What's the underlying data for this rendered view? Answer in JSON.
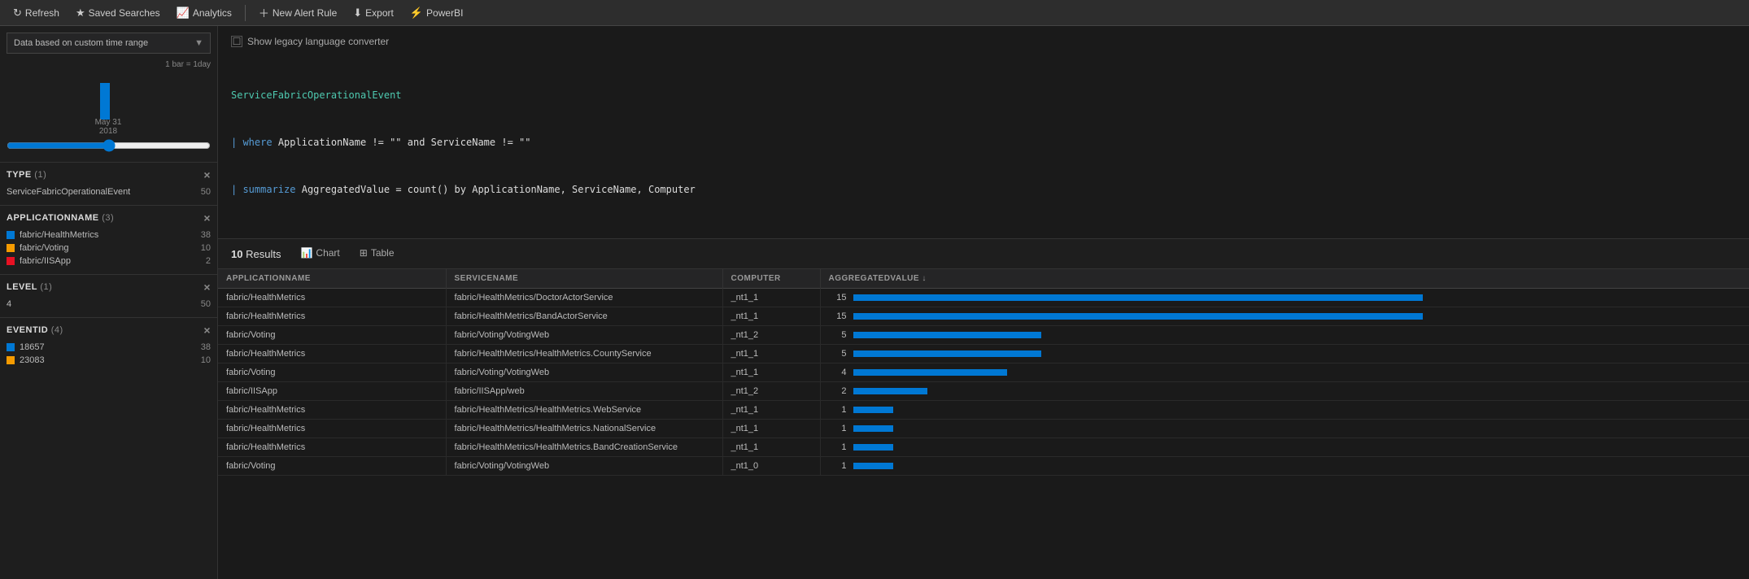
{
  "nav": {
    "refresh_label": "Refresh",
    "saved_searches_label": "Saved Searches",
    "analytics_label": "Analytics",
    "new_alert_label": "New Alert Rule",
    "export_label": "Export",
    "powerbi_label": "PowerBI"
  },
  "sidebar": {
    "time_range_label": "Data based on custom time range",
    "bar_scale": "1 bar = 1day",
    "date_label": "May 31",
    "date_year": "2018",
    "filters": [
      {
        "name": "TYPE",
        "count_label": "(1)",
        "items": [
          {
            "label": "ServiceFabricOperationalEvent",
            "count": 50,
            "checked": false,
            "color": null
          }
        ]
      },
      {
        "name": "APPLICATIONNAME",
        "count_label": "(3)",
        "items": [
          {
            "label": "fabric/HealthMetrics",
            "count": 38,
            "checked": false,
            "color": "#0078d4"
          },
          {
            "label": "fabric/Voting",
            "count": 10,
            "checked": false,
            "color": "#f59b00"
          },
          {
            "label": "fabric/IISApp",
            "count": 2,
            "checked": false,
            "color": "#e81123"
          }
        ]
      },
      {
        "name": "LEVEL",
        "count_label": "(1)",
        "items": [
          {
            "label": "4",
            "count": 50,
            "checked": false,
            "color": null
          }
        ]
      },
      {
        "name": "EVENTID",
        "count_label": "(4)",
        "items": [
          {
            "label": "18657",
            "count": 38,
            "checked": false,
            "color": "#0078d4"
          },
          {
            "label": "23083",
            "count": 10,
            "checked": false,
            "color": "#f59b00"
          }
        ]
      }
    ]
  },
  "query": {
    "legacy_toggle_label": "Show legacy language converter",
    "lines": [
      "ServiceFabricOperationalEvent",
      "| where ApplicationName != \"\" and ServiceName != \"\"",
      "| summarize AggregatedValue = count() by ApplicationName, ServiceName, Computer"
    ]
  },
  "results": {
    "count": "10",
    "count_label": "Results",
    "tabs": [
      {
        "label": "Chart",
        "icon": "📊",
        "active": false
      },
      {
        "label": "Table",
        "icon": "⊞",
        "active": false
      }
    ]
  },
  "table": {
    "columns": [
      {
        "key": "applicationname",
        "label": "APPLICATIONNAME"
      },
      {
        "key": "servicename",
        "label": "SERVICENAME"
      },
      {
        "key": "computer",
        "label": "COMPUTER"
      },
      {
        "key": "aggregatedvalue",
        "label": "AGGREGATEDVALUE ↓"
      }
    ],
    "rows": [
      {
        "applicationname": "fabric/HealthMetrics",
        "servicename": "fabric/HealthMetrics/DoctorActorService",
        "computer": "_nt1_1",
        "aggregatedvalue": 15,
        "bar_pct": 100
      },
      {
        "applicationname": "fabric/HealthMetrics",
        "servicename": "fabric/HealthMetrics/BandActorService",
        "computer": "_nt1_1",
        "aggregatedvalue": 15,
        "bar_pct": 100
      },
      {
        "applicationname": "fabric/Voting",
        "servicename": "fabric/Voting/VotingWeb",
        "computer": "_nt1_2",
        "aggregatedvalue": 5,
        "bar_pct": 33
      },
      {
        "applicationname": "fabric/HealthMetrics",
        "servicename": "fabric/HealthMetrics/HealthMetrics.CountyService",
        "computer": "_nt1_1",
        "aggregatedvalue": 5,
        "bar_pct": 33
      },
      {
        "applicationname": "fabric/Voting",
        "servicename": "fabric/Voting/VotingWeb",
        "computer": "_nt1_1",
        "aggregatedvalue": 4,
        "bar_pct": 27
      },
      {
        "applicationname": "fabric/IISApp",
        "servicename": "fabric/IISApp/web",
        "computer": "_nt1_2",
        "aggregatedvalue": 2,
        "bar_pct": 13
      },
      {
        "applicationname": "fabric/HealthMetrics",
        "servicename": "fabric/HealthMetrics/HealthMetrics.WebService",
        "computer": "_nt1_1",
        "aggregatedvalue": 1,
        "bar_pct": 7
      },
      {
        "applicationname": "fabric/HealthMetrics",
        "servicename": "fabric/HealthMetrics/HealthMetrics.NationalService",
        "computer": "_nt1_1",
        "aggregatedvalue": 1,
        "bar_pct": 7
      },
      {
        "applicationname": "fabric/HealthMetrics",
        "servicename": "fabric/HealthMetrics/HealthMetrics.BandCreationService",
        "computer": "_nt1_1",
        "aggregatedvalue": 1,
        "bar_pct": 7
      },
      {
        "applicationname": "fabric/Voting",
        "servicename": "fabric/Voting/VotingWeb",
        "computer": "_nt1_0",
        "aggregatedvalue": 1,
        "bar_pct": 7
      }
    ]
  }
}
